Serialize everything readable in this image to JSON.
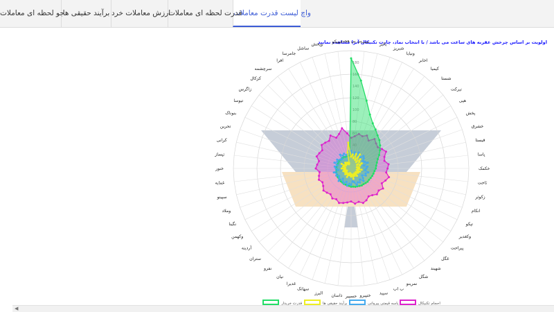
{
  "tabs": [
    {
      "label": "واچ لیست قدرت معاملات",
      "active": true
    },
    {
      "label": "قدرت لحظه ای معاملات",
      "active": false
    },
    {
      "label": "ارزش معاملات خرد",
      "active": false
    },
    {
      "label": "برآیند حقیقی ها",
      "active": false
    },
    {
      "label": "جو لحظه ای معاملات",
      "active": false
    }
  ],
  "notice": "اولویت بر اساس چرخش عقربه های ساعت می باشد / با انتخاب نماد، چارت تکنیکال آنرا مشاهده نمایید",
  "colors": {
    "active_tab": "#3b5bd6",
    "series_green": "#22dd66",
    "series_yellow": "#eeee22",
    "series_blue": "#44aaee",
    "series_magenta": "#dd22cc",
    "band_gray": "#b3bccb",
    "band_orange": "#f3d4a6"
  },
  "chart_data": {
    "type": "radar",
    "symbols": [
      "پی پی هجت",
      "سپ",
      "بالبر",
      "شبریز",
      "ونیایا",
      "اخابر",
      "کیمیا",
      "شستا",
      "نیرکت",
      "هپی",
      "پخش",
      "خشرق",
      "قیستا",
      "پاسا",
      "خکمک",
      "ثاخت",
      "زکوثر",
      "انکام",
      "تپکو",
      "وکغدیر",
      "پیراحت",
      "غگل",
      "شهیند",
      "شگل",
      "نمرینو",
      "ب اب",
      "سپید",
      "ختپیرو",
      "حسپیر",
      "ذاسان",
      "البرز",
      "سهاتک",
      "غدیرا",
      "نیان",
      "نفرو",
      "ستران",
      "آردینه",
      "وکهمن",
      "نگینا",
      "وملاد",
      "سپینو",
      "غمایه",
      "خنور",
      "تپساز",
      "کرانی",
      "تحرین",
      "بنوناک",
      "تیوسا",
      "زاگرس",
      "کزکال",
      "سرچشمه",
      "افرا",
      "جامرسا",
      "ساشل",
      "وپخش",
      "تیپیکو"
    ],
    "series": [
      {
        "name": "قدرت خریدار",
        "color": "green",
        "values": [
          187,
          150,
          118,
          97,
          85,
          78,
          72,
          68,
          63,
          58,
          53,
          48,
          45,
          43,
          42,
          40,
          39,
          38,
          37,
          36,
          36,
          35,
          34,
          34,
          33,
          32,
          32,
          31,
          31,
          30,
          30,
          29,
          29,
          28,
          28,
          27,
          27,
          27,
          26,
          26,
          26,
          25,
          25,
          25,
          24,
          24,
          24,
          24,
          23,
          23,
          23,
          23,
          22,
          22,
          22,
          22
        ]
      },
      {
        "name": "برآیند حقیقی ها",
        "color": "yellow",
        "values": [
          20,
          24,
          18,
          26,
          16,
          28,
          14,
          22,
          18,
          12,
          20,
          16,
          10,
          14,
          12,
          18,
          10,
          16,
          12,
          14,
          10,
          12,
          16,
          10,
          14,
          12,
          18,
          10,
          14,
          12,
          8,
          12,
          16,
          10,
          12,
          14,
          10,
          12,
          8,
          14,
          10,
          12,
          16,
          10,
          14,
          12,
          18,
          10,
          12,
          14,
          10,
          12,
          8,
          10,
          28,
          44
        ]
      },
      {
        "name": "پاسه قیمتی پیروانی",
        "color": "blue",
        "values": [
          30,
          24,
          28,
          22,
          30,
          26,
          24,
          30,
          28,
          24,
          26,
          30,
          22,
          28,
          26,
          24,
          30,
          26,
          28,
          22,
          26,
          30,
          24,
          28,
          26,
          30,
          24,
          22,
          28,
          26,
          30,
          24,
          28,
          26,
          22,
          30,
          26,
          24,
          28,
          26,
          30,
          22,
          26,
          28,
          24,
          30,
          26,
          28,
          24,
          22,
          30,
          26,
          28,
          24,
          26,
          30
        ]
      },
      {
        "name": "احجام تکنیکال",
        "color": "magenta",
        "values": [
          52,
          55,
          60,
          58,
          62,
          56,
          64,
          60,
          58,
          62,
          66,
          60,
          58,
          64,
          62,
          60,
          66,
          62,
          58,
          64,
          60,
          62,
          58,
          56,
          60,
          62,
          58,
          60,
          56,
          58,
          60,
          62,
          58,
          60,
          56,
          58,
          60,
          56,
          54,
          58,
          56,
          54,
          60,
          58,
          56,
          62,
          60,
          58,
          64,
          62,
          60,
          66,
          58,
          62,
          70,
          60
        ]
      }
    ],
    "rlim": [
      0,
      200
    ],
    "radial_ticks": [
      40,
      60,
      80,
      100,
      120,
      140,
      160,
      180
    ],
    "grid": true,
    "legend_position": "bottom"
  }
}
